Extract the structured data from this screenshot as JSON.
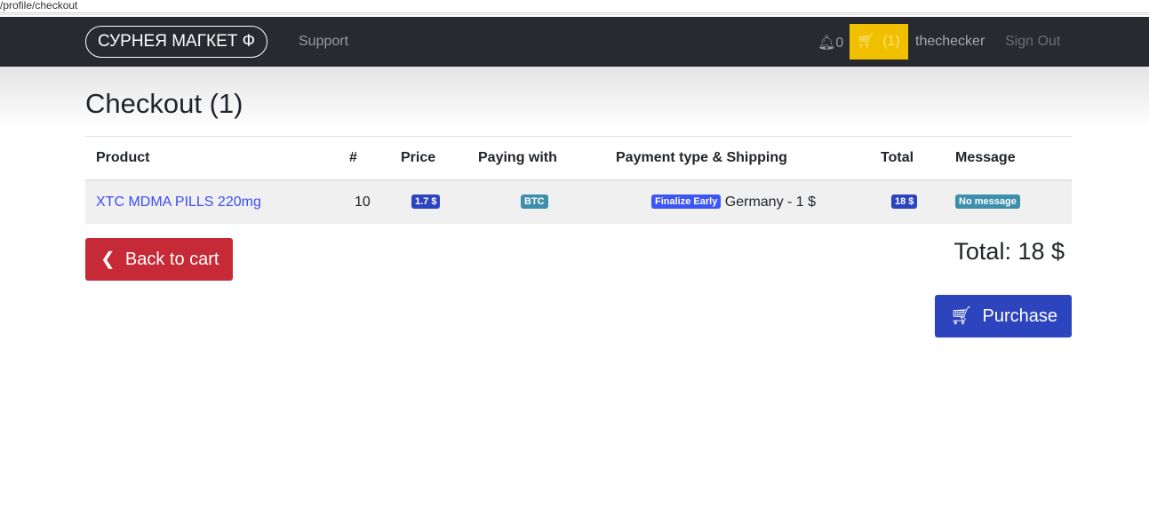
{
  "browser": {
    "url": "/profile/checkout"
  },
  "nav": {
    "brand": "СУРНЕЯ МАГКЕТ Ф",
    "support": "Support",
    "notifications": "0",
    "cart_count": "(1)",
    "username": "thechecker",
    "sign_out": "Sign Out"
  },
  "page": {
    "title": "Checkout (1)"
  },
  "table": {
    "headers": [
      "Product",
      "#",
      "Price",
      "Paying with",
      "Payment type & Shipping",
      "Total",
      "Message"
    ],
    "rows": [
      {
        "product": "XTC MDMA PILLS 220mg",
        "qty": "10",
        "price": "1.7 $",
        "paying_with": "BTC",
        "payment_type": "Finalize Early",
        "shipping": "Germany - 1 $",
        "total": "18 $",
        "message": "No message"
      }
    ]
  },
  "actions": {
    "back": "Back to cart",
    "total": "Total: 18 $",
    "purchase": "Purchase"
  },
  "colors": {
    "navbar": "#272a2f",
    "cart": "#f0bf00",
    "danger": "#c62a36",
    "primary": "#2c44be",
    "info": "#3d8fab"
  }
}
